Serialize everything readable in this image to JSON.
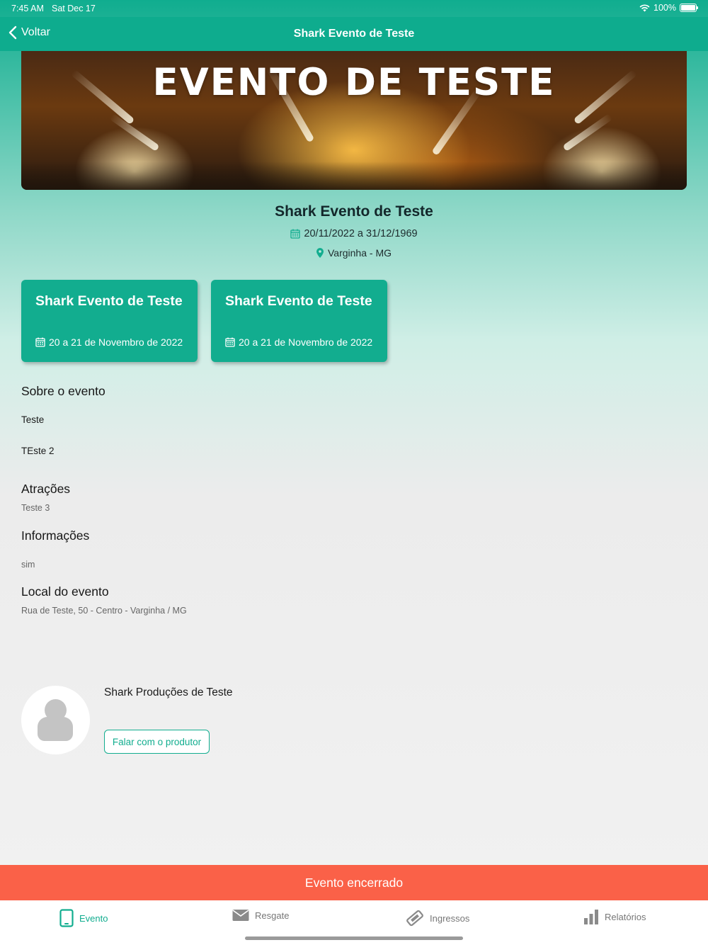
{
  "status": {
    "time": "7:45 AM",
    "date": "Sat Dec 17",
    "battery": "100%"
  },
  "nav": {
    "back_label": "Voltar",
    "title": "Shark Evento de Teste"
  },
  "banner": {
    "text": "EVENTO DE TESTE"
  },
  "event": {
    "title": "Shark Evento de Teste",
    "dates": "20/11/2022 a 31/12/1969",
    "city": "Varginha - MG"
  },
  "cards": [
    {
      "title": "Shark Evento de Teste",
      "date": "20 a 21 de Novembro de 2022"
    },
    {
      "title": "Shark Evento de Teste",
      "date": "20 a 21 de Novembro de 2022"
    }
  ],
  "about": {
    "heading": "Sobre o evento",
    "lines": [
      "Teste",
      "TEste 2"
    ]
  },
  "attractions": {
    "heading": "Atrações",
    "text": "Teste 3"
  },
  "info": {
    "heading": "Informações",
    "text": "sim"
  },
  "location": {
    "heading": "Local do evento",
    "address": "Rua de Teste, 50 - Centro - Varginha / MG"
  },
  "producer": {
    "name": "Shark Produções de Teste",
    "contact_label": "Falar com o produtor"
  },
  "closed_label": "Evento encerrado",
  "tabs": [
    {
      "label": "Evento",
      "icon": "tablet-icon",
      "active": true
    },
    {
      "label": "Resgate",
      "icon": "envelope-icon",
      "active": false
    },
    {
      "label": "Ingressos",
      "icon": "ticket-icon",
      "active": false
    },
    {
      "label": "Relatórios",
      "icon": "bar-chart-icon",
      "active": false
    }
  ],
  "colors": {
    "accent": "#12ad8f",
    "closed": "#fa6148"
  }
}
